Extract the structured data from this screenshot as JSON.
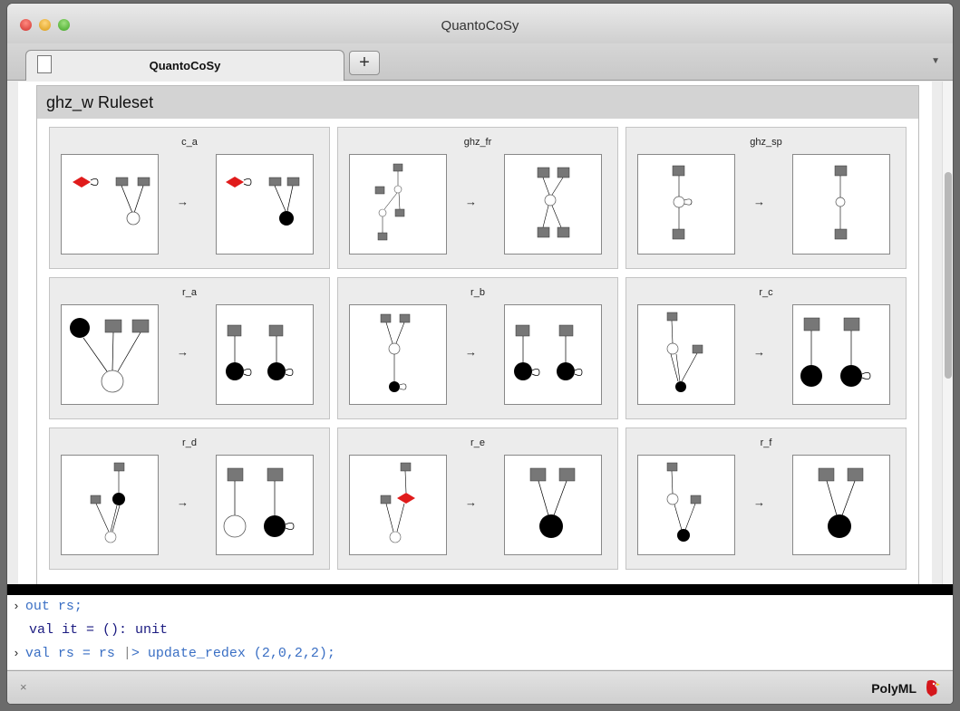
{
  "window": {
    "title": "QuantoCoSy"
  },
  "tabs": {
    "active_label": "QuantoCoSy",
    "add_label": "+"
  },
  "ruleset": {
    "title": "ghz_w Ruleset"
  },
  "rules": [
    {
      "name": "c_a"
    },
    {
      "name": "ghz_fr"
    },
    {
      "name": "ghz_sp"
    },
    {
      "name": "r_a"
    },
    {
      "name": "r_b"
    },
    {
      "name": "r_c"
    },
    {
      "name": "r_d"
    },
    {
      "name": "r_e"
    },
    {
      "name": "r_f"
    }
  ],
  "rule_arrow": "→",
  "console": {
    "prompt": "›",
    "line1": "out rs;",
    "line2": "val it = (): unit",
    "line3_before": "val rs = rs ",
    "line3_after": "> update_redex (2,0,2,2);"
  },
  "status": {
    "close_glyph": "×",
    "label": "PolyML"
  },
  "colors": {
    "red_node": "#e01b1b",
    "black_node": "#000000",
    "boundary_node": "#777777"
  }
}
